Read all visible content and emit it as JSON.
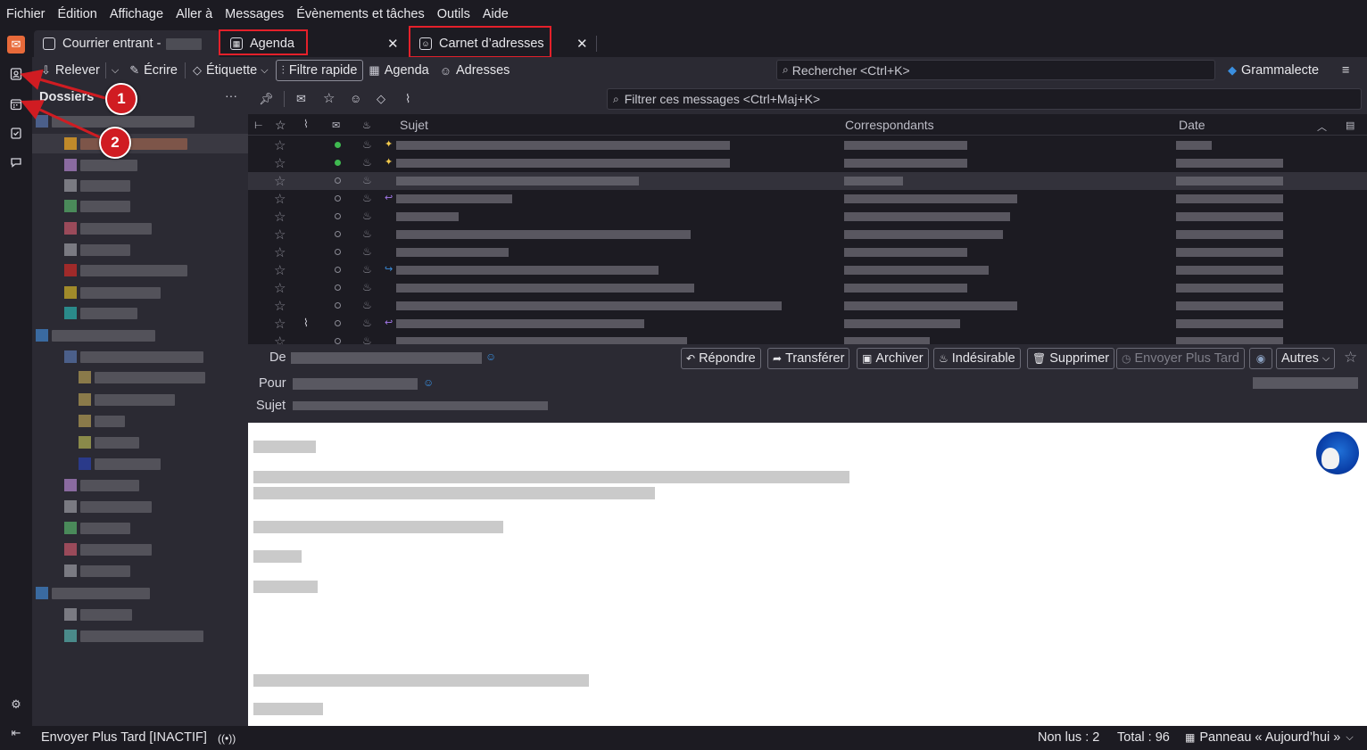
{
  "menubar": {
    "items": [
      "Fichier",
      "Édition",
      "Affichage",
      "Aller à",
      "Messages",
      "Évènements et tâches",
      "Outils",
      "Aide"
    ]
  },
  "spaces": {
    "icons": [
      "mail-icon",
      "address-book-icon",
      "calendar-icon",
      "tasks-icon",
      "chat-icon",
      "settings-icon",
      "collapse-icon"
    ]
  },
  "tabs": [
    {
      "label": "Courrier entrant -",
      "icon": "inbox-icon"
    },
    {
      "label": "Agenda",
      "icon": "calendar-icon"
    },
    {
      "label": "Carnet d’adresses",
      "icon": "address-book-icon"
    }
  ],
  "toolbar": {
    "get_messages": "Relever",
    "write": "Écrire",
    "tag": "Étiquette",
    "quick_filter": "Filtre rapide",
    "calendar": "Agenda",
    "address_book": "Adresses",
    "search_placeholder": "Rechercher <Ctrl+K>",
    "grammalecte": "Grammalecte"
  },
  "folders": {
    "header": "Dossiers",
    "more": "···"
  },
  "message_list": {
    "filter_placeholder": "Filtrer ces messages <Ctrl+Maj+K>",
    "columns": {
      "subject": "Sujet",
      "correspondents": "Correspondants",
      "date": "Date"
    }
  },
  "header_pane": {
    "from_label": "De",
    "to_label": "Pour",
    "subject_label": "Sujet",
    "buttons": {
      "reply": "Répondre",
      "forward": "Transférer",
      "archive": "Archiver",
      "junk": "Indésirable",
      "delete": "Supprimer",
      "send_later": "Envoyer Plus Tard",
      "other": "Autres"
    }
  },
  "statusbar": {
    "send_later": "Envoyer Plus Tard [INACTIF]",
    "unread": "Non lus : 2",
    "total": "Total : 96",
    "today_pane": "Panneau « Aujourd’hui »"
  },
  "callouts": [
    "1",
    "2"
  ],
  "colors": {
    "accent": "#e4202a",
    "background": "#1c1b22",
    "panel": "#2b2a33",
    "unread_dot": "#3fb950"
  }
}
